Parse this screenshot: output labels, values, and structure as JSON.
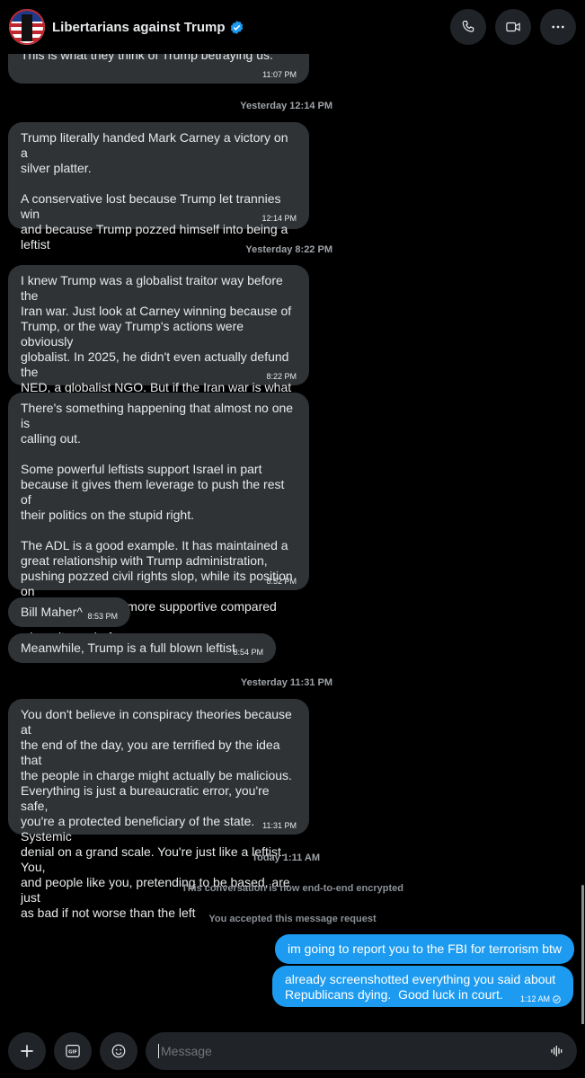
{
  "header": {
    "name": "Libertarians against Trump"
  },
  "messages": [
    {
      "text": "This is what they think of Trump betraying us.",
      "time": "11:07 PM"
    },
    {
      "text": "Trump literally handed Mark Carney a victory on a\nsilver platter.\n\nA conservative lost because Trump let trannies win\nand because Trump pozzed himself into being a\nleftist",
      "time": "12:14 PM"
    },
    {
      "text": "I knew Trump was a globalist traitor way before the\nIran war. Just look at Carney winning because of\nTrump, or the way Trump's actions were obviously\nglobalist. In 2025, he didn't even actually defund the\nNED, a globalist NGO. But if the Iran war is what\nfinally makes people turn against Trump, I'll take it.",
      "time": "8:22 PM"
    },
    {
      "text": "There's something happening that almost no one is\ncalling out.\n\nSome powerful leftists support Israel in part\nbecause it gives them leverage to push the rest of\ntheir politics on the stupid right.\n\nThe ADL is a good example. It has maintained a\ngreat relationship with Trump administration,\npushing pozzed civil rights slop, while its position on\nIsrael has become more supportive compared with\nwhere it was before.",
      "time": "8:52 PM"
    },
    {
      "text": "Bill Maher^",
      "time": "8:53 PM"
    },
    {
      "text": "Meanwhile, Trump is a full blown leftist",
      "time": "8:54 PM"
    },
    {
      "text": "You don't believe in conspiracy theories because at\nthe end of the day, you are terrified by the idea that\nthe people in charge might actually be malicious.\nEverything is just a bureaucratic error, you're safe,\nyou're a protected beneficiary of the state. Systemic\ndenial on a grand scale. You're just like a leftist. You,\nand people like you, pretending to be based, are just\nas bad if not worse than the left",
      "time": "11:31 PM"
    }
  ],
  "date_separators": [
    "Yesterday 12:14 PM",
    "Yesterday 8:22 PM",
    "Yesterday 11:31 PM",
    "Today 1:11 AM"
  ],
  "system": {
    "encrypted": "This conversation is now end-to-end encrypted",
    "accepted": "You accepted this message request"
  },
  "outgoing": [
    {
      "text": "im going to report you to the FBI for terrorism btw"
    },
    {
      "text": "already screenshotted everything you said about\nRepublicans dying.  Good luck in court.",
      "time": "1:12 AM"
    }
  ],
  "composer": {
    "placeholder": "Message"
  },
  "colors": {
    "accent": "#1d9bf0",
    "incoming_bubble": "#2f3336",
    "background": "#000000"
  },
  "icons": [
    "phone-icon",
    "video-icon",
    "more-icon",
    "plus-icon",
    "gif-icon",
    "emoji-icon",
    "voice-icon",
    "verified-icon",
    "read-receipt-icon"
  ]
}
